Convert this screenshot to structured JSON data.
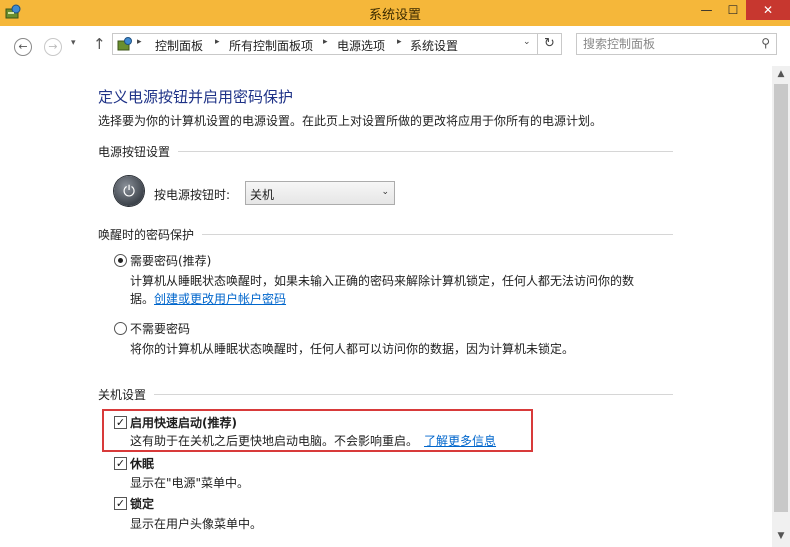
{
  "window": {
    "title": "系统设置",
    "min_glyph": "—",
    "max_glyph": "☐",
    "close_glyph": "✕"
  },
  "nav": {
    "back_glyph": "←",
    "forward_glyph": "→",
    "history_glyph": "▾",
    "up_glyph": "↑",
    "breadcrumbs": [
      "控制面板",
      "所有控制面板项",
      "电源选项",
      "系统设置"
    ],
    "separator_glyph": "▸",
    "dropdown_glyph": "⌄",
    "refresh_glyph": "↻"
  },
  "search": {
    "placeholder": "搜索控制面板",
    "icon": "search-icon",
    "icon_glyph": "⚲"
  },
  "page": {
    "title": "定义电源按钮并启用密码保护",
    "description": "选择要为你的计算机设置的电源设置。在此页上对设置所做的更改将应用于你所有的电源计划。"
  },
  "power_section": {
    "label": "电源按钮设置",
    "power_icon_glyph": "⏻",
    "button_label": "按电源按钮时:",
    "selected": "关机",
    "dropdown_glyph": "⌄"
  },
  "wake_section": {
    "label": "唤醒时的密码保护",
    "require": {
      "label": "需要密码(推荐)",
      "selected": true,
      "desc_line1": "计算机从睡眠状态唤醒时，如果未输入正确的密码来解除计算机锁定，任何人都无法访问你的数",
      "desc_line2_prefix": "据。",
      "link": "创建或更改用户帐户密码"
    },
    "no_require": {
      "label": "不需要密码",
      "selected": false,
      "desc": "将你的计算机从睡眠状态唤醒时，任何人都可以访问你的数据，因为计算机未锁定。"
    }
  },
  "shutdown_section": {
    "label": "关机设置",
    "check_glyph": "✓",
    "items": [
      {
        "label": "启用快速启动(推荐)",
        "checked": true,
        "desc": "这有助于在关机之后更快地启动电脑。不会影响重启。",
        "link": "了解更多信息"
      },
      {
        "label": "休眠",
        "checked": true,
        "desc": "显示在\"电源\"菜单中。"
      },
      {
        "label": "锁定",
        "checked": true,
        "desc": "显示在用户头像菜单中。"
      }
    ]
  },
  "scrollbar": {
    "up_glyph": "▲",
    "down_glyph": "▼"
  },
  "colors": {
    "titlebar": "#f5b73a",
    "heading": "#1e3287",
    "link": "#0066cc",
    "highlight_border": "#d83a3a",
    "close_button": "#c7372f"
  }
}
